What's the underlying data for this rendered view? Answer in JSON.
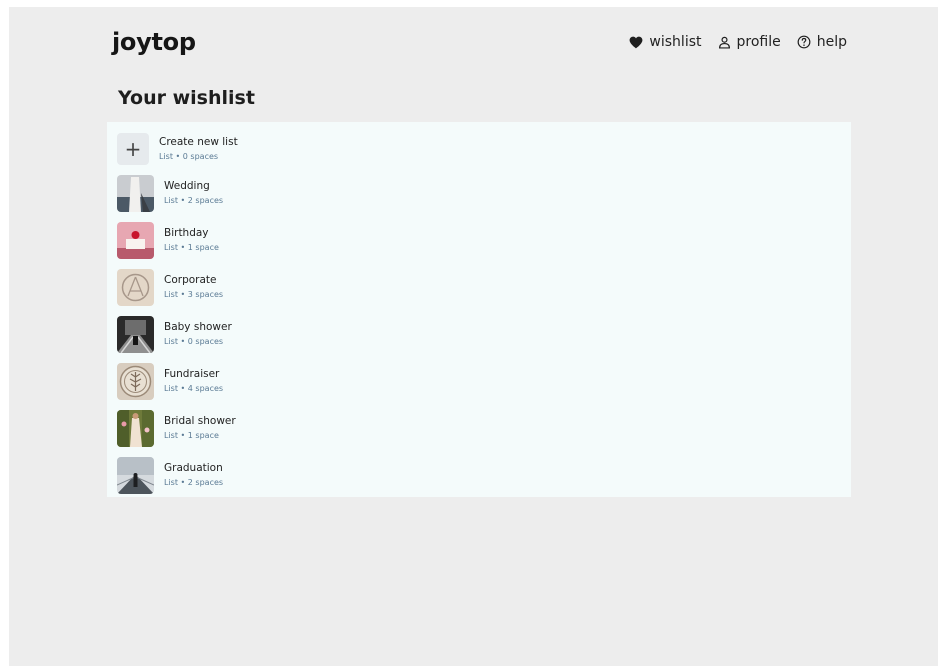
{
  "brand": {
    "logo": "joytop"
  },
  "nav": {
    "wishlist": {
      "label": "wishlist",
      "icon": "heart-icon"
    },
    "profile": {
      "label": "profile",
      "icon": "user-icon"
    },
    "help": {
      "label": "help",
      "icon": "help-circle-icon"
    }
  },
  "page": {
    "title": "Your wishlist"
  },
  "create": {
    "title": "Create new list",
    "subtitle": "List • 0 spaces",
    "icon": "plus-icon"
  },
  "lists": [
    {
      "title": "Wedding",
      "subtitle": "List • 2 spaces"
    },
    {
      "title": "Birthday",
      "subtitle": "List • 1 space"
    },
    {
      "title": "Corporate",
      "subtitle": "List • 3 spaces"
    },
    {
      "title": "Baby shower",
      "subtitle": "List • 0 spaces"
    },
    {
      "title": "Fundraiser",
      "subtitle": "List • 4 spaces"
    },
    {
      "title": "Bridal shower",
      "subtitle": "List • 1 space"
    },
    {
      "title": "Graduation",
      "subtitle": "List • 2 spaces"
    }
  ],
  "colors": {
    "background": "#ededed",
    "panel": "#f4fbfb",
    "subtitle": "#5a7a94"
  }
}
